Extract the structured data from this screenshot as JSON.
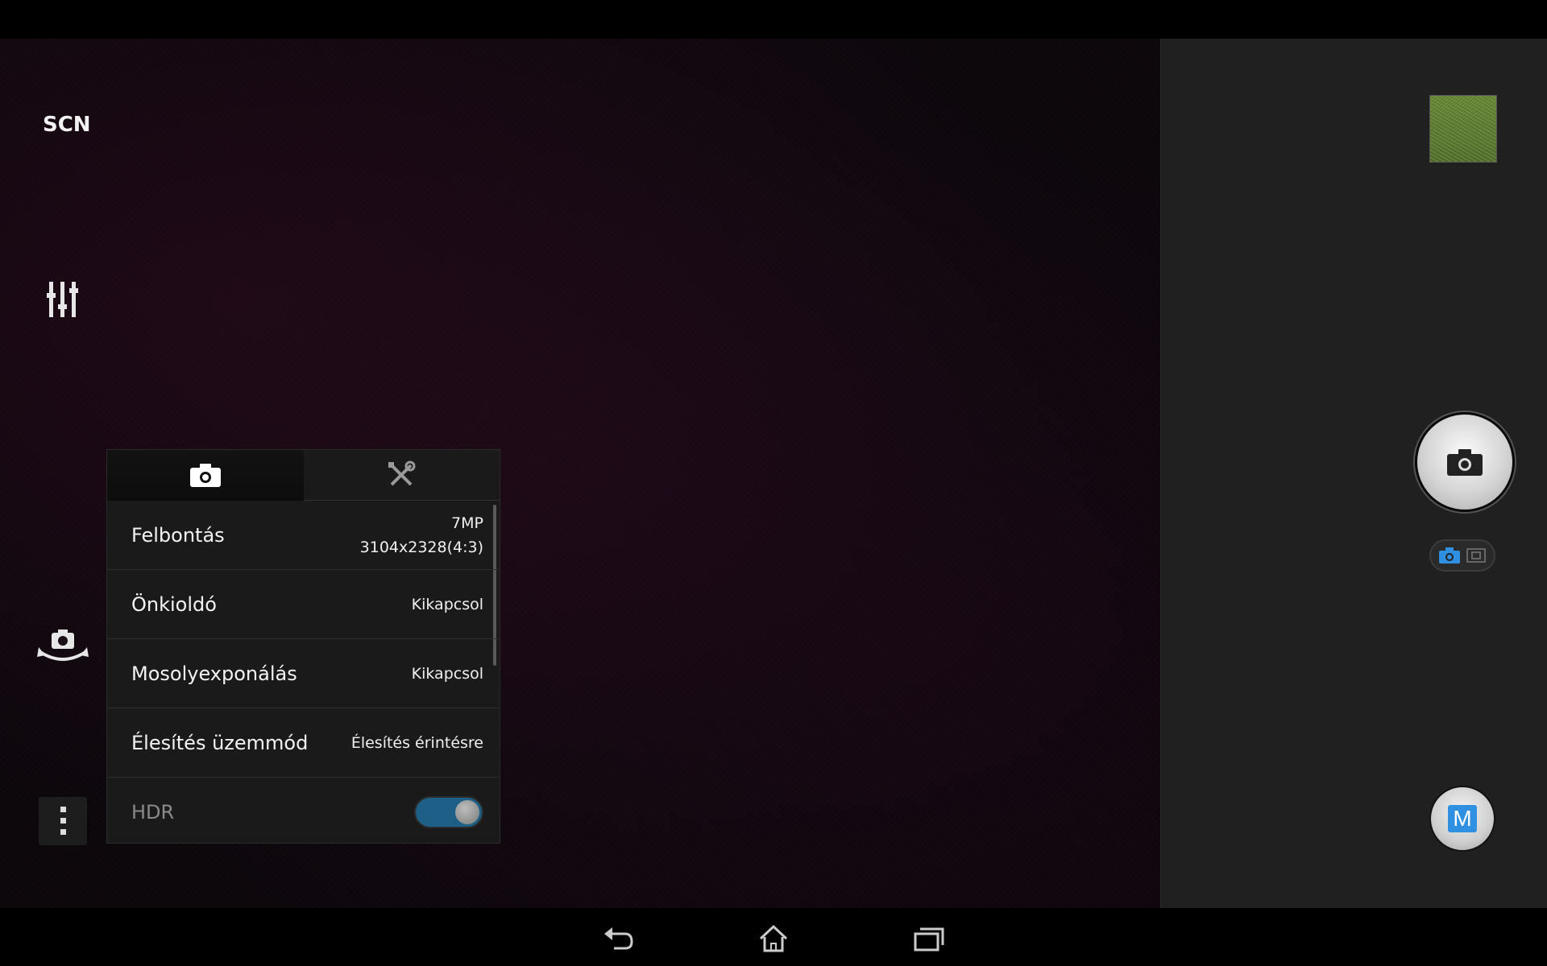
{
  "left_controls": {
    "scene_label": "SCN"
  },
  "settings_panel": {
    "tabs": [
      {
        "name": "camera-settings",
        "icon": "camera-icon"
      },
      {
        "name": "general-settings",
        "icon": "tools-icon"
      }
    ],
    "rows": [
      {
        "label": "Felbontás",
        "value_line1": "7MP",
        "value_line2": "3104x2328(4:3)"
      },
      {
        "label": "Önkioldó",
        "value": "Kikapcsol"
      },
      {
        "label": "Mosolyexponálás",
        "value": "Kikapcsol"
      },
      {
        "label": "Élesítés üzemmód",
        "value": "Élesítés érintésre"
      },
      {
        "label": "HDR",
        "toggle": "on"
      }
    ]
  },
  "right_panel": {
    "manual_mode_label": "M"
  },
  "colors": {
    "accent": "#2f8fe0",
    "toggle_track": "#1d5f86",
    "panel_bg": "#1a1a1a",
    "right_panel_bg": "#202020"
  },
  "nav": [
    "back-icon",
    "home-icon",
    "recent-apps-icon"
  ]
}
